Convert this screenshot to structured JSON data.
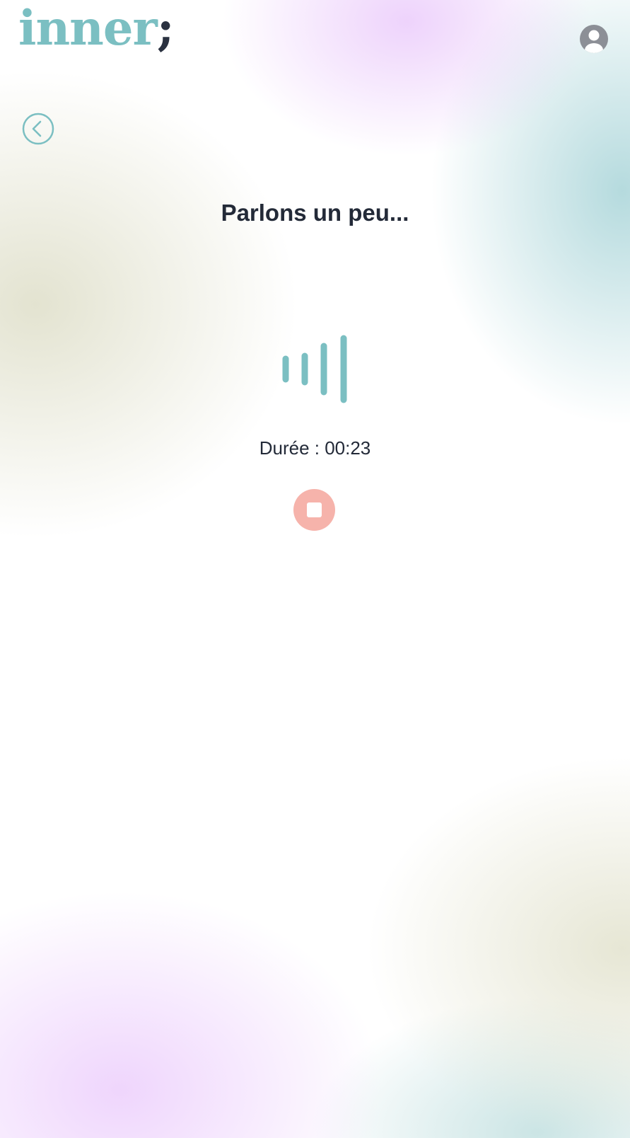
{
  "header": {
    "logo_word": "inner",
    "logo_mark": ";",
    "avatar_icon": "user-avatar-icon"
  },
  "nav": {
    "back_icon": "chevron-left-circle-icon"
  },
  "recorder": {
    "title": "Parlons un peu...",
    "duration_text": "Durée : 00:23",
    "waveform_icon": "audio-waveform-icon",
    "stop_icon": "stop-icon"
  },
  "colors": {
    "accent": "#7bbfc2",
    "text": "#232a38",
    "stop_button": "#f6b3ab",
    "avatar": "#8c8f96"
  }
}
